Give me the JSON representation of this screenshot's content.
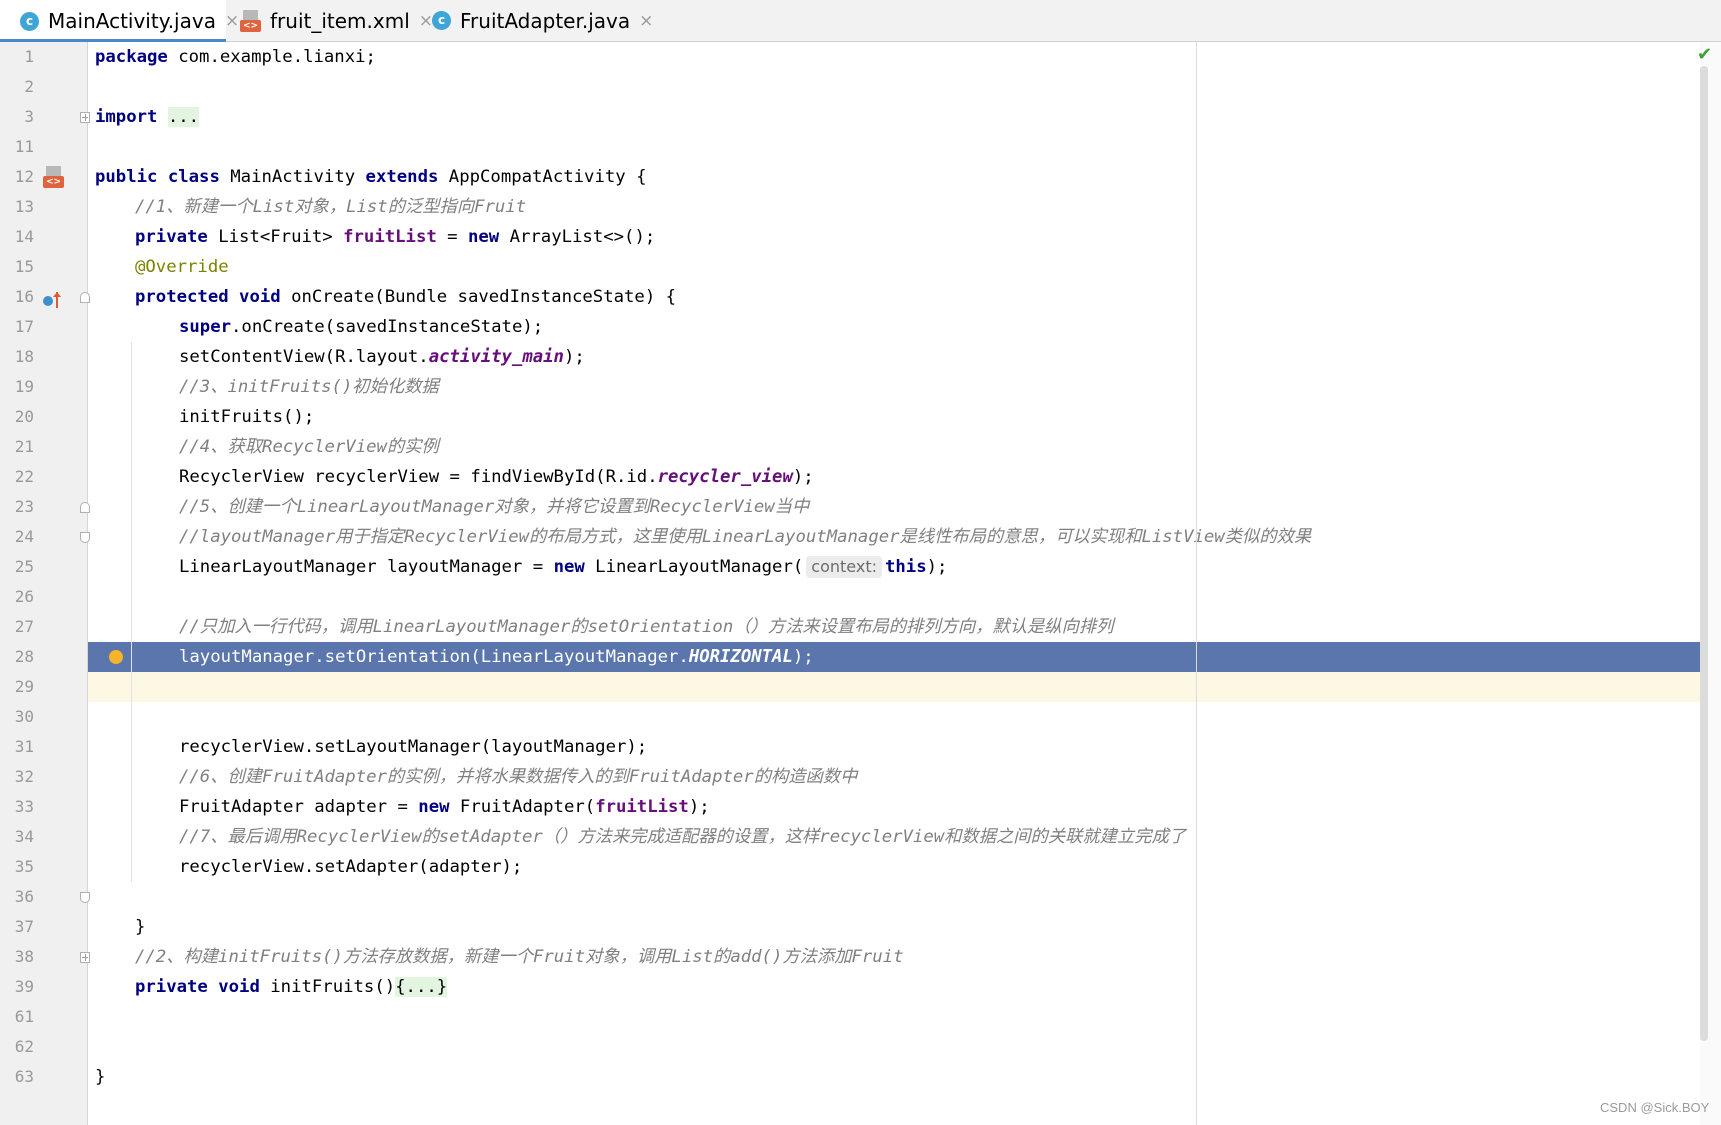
{
  "tabs": [
    {
      "label": "MainActivity.java",
      "icon": "c",
      "active": true
    },
    {
      "label": "fruit_item.xml",
      "icon": "xml",
      "active": false
    },
    {
      "label": "FruitAdapter.java",
      "icon": "c",
      "active": false
    }
  ],
  "tab_icon_letter": "c",
  "xml_icon_letter": "<>",
  "close_glyph": "×",
  "check_glyph": "✔",
  "lines": [
    {
      "n": "1"
    },
    {
      "n": "2"
    },
    {
      "n": "3"
    },
    {
      "n": "11"
    },
    {
      "n": "12"
    },
    {
      "n": "13"
    },
    {
      "n": "14"
    },
    {
      "n": "15"
    },
    {
      "n": "16"
    },
    {
      "n": "17"
    },
    {
      "n": "18"
    },
    {
      "n": "19"
    },
    {
      "n": "20"
    },
    {
      "n": "21"
    },
    {
      "n": "22"
    },
    {
      "n": "23"
    },
    {
      "n": "24"
    },
    {
      "n": "25"
    },
    {
      "n": "26"
    },
    {
      "n": "27"
    },
    {
      "n": "28"
    },
    {
      "n": "29"
    },
    {
      "n": "30"
    },
    {
      "n": "31"
    },
    {
      "n": "32"
    },
    {
      "n": "33"
    },
    {
      "n": "34"
    },
    {
      "n": "35"
    },
    {
      "n": "36"
    },
    {
      "n": "37"
    },
    {
      "n": "38"
    },
    {
      "n": "39"
    },
    {
      "n": "61"
    },
    {
      "n": "62"
    },
    {
      "n": "63"
    }
  ],
  "code": {
    "l1": {
      "kw": "package",
      "rest": " com.example.lianxi;"
    },
    "l3": {
      "kw": "import",
      "dots": "..."
    },
    "l12": {
      "kw1": "public",
      "kw2": "class",
      "name": " MainActivity ",
      "kw3": "extends",
      "rest": " AppCompatActivity {"
    },
    "l13": {
      "cmt": "//1、新建一个List对象，List的泛型指向Fruit"
    },
    "l14": {
      "kw": "private",
      "a": " List<Fruit> ",
      "fld": "fruitList",
      "b": " = ",
      "kw2": "new",
      "c": " ArrayList<>();"
    },
    "l15": {
      "ann": "@Override"
    },
    "l16": {
      "kw1": "protected",
      "kw2": "void",
      "rest": " onCreate(Bundle savedInstanceState) {"
    },
    "l17": {
      "kw": "super",
      "rest": ".onCreate(savedInstanceState);"
    },
    "l18": {
      "a": "setContentView(R.layout.",
      "sfld": "activity_main",
      "b": ");"
    },
    "l19": {
      "cmt": "//3、initFruits()初始化数据"
    },
    "l20": {
      "text": "initFruits();"
    },
    "l21": {
      "cmt": "//4、获取RecyclerView的实例"
    },
    "l22": {
      "a": "RecyclerView recyclerView = findViewById(R.id.",
      "sfld": "recycler_view",
      "b": ");"
    },
    "l23": {
      "cmt": "//5、创建一个LinearLayoutManager对象，并将它设置到RecyclerView当中"
    },
    "l24": {
      "cmt": "//layoutManager用于指定RecyclerView的布局方式，这里使用LinearLayoutManager是线性布局的意思，可以实现和ListView类似的效果"
    },
    "l25": {
      "a": "LinearLayoutManager layoutManager = ",
      "kw": "new",
      "b": " LinearLayoutManager(",
      "hint": "context:",
      "kw2": "this",
      "c": ");"
    },
    "l27": {
      "cmt": "//只加入一行代码，调用LinearLayoutManager的setOrientation（）方法来设置布局的排列方向，默认是纵向排列"
    },
    "l28": {
      "a": "layoutManager.setOrientation(LinearLayoutManager.",
      "sfld": "HORIZONTAL",
      "b": ");"
    },
    "l31": {
      "text": "recyclerView.setLayoutManager(layoutManager);"
    },
    "l32": {
      "cmt": "//6、创建FruitAdapter的实例，并将水果数据传入的到FruitAdapter的构造函数中"
    },
    "l33": {
      "a": "FruitAdapter adapter = ",
      "kw": "new",
      "b": " FruitAdapter(",
      "fld": "fruitList",
      "c": ");"
    },
    "l34": {
      "cmt": "//7、最后调用RecyclerView的setAdapter（）方法来完成适配器的设置，这样recyclerView和数据之间的关联就建立完成了"
    },
    "l35": {
      "text": "recyclerView.setAdapter(adapter);"
    },
    "l37": {
      "text": "}"
    },
    "l38": {
      "cmt": "//2、构建initFruits()方法存放数据，新建一个Fruit对象，调用List的add()方法添加Fruit"
    },
    "l39": {
      "kw1": "private",
      "kw2": "void",
      "a": " initFruits()",
      "dots": "{...}"
    },
    "l63": {
      "text": "}"
    }
  },
  "watermark": "CSDN @Sick.BOY",
  "colors": {
    "keyword": "#000080",
    "comment": "#808080",
    "annotation": "#808000",
    "field": "#660e7a",
    "highlight_line": "#5a76ad",
    "caret_line": "#fcf8e3",
    "breakpoint": "#f5b42a",
    "tab_accent": "#4a88c7"
  }
}
